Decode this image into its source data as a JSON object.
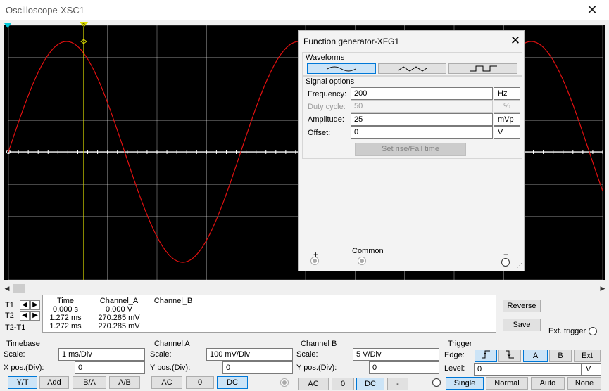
{
  "window": {
    "title": "Oscilloscope-XSC1",
    "close": "✕"
  },
  "cursors": {
    "t1": "1",
    "t2": "2"
  },
  "readout": {
    "headers": {
      "time": "Time",
      "channel_a": "Channel_A",
      "channel_b": "Channel_B"
    },
    "rows": [
      {
        "label": "T1",
        "time": "0.000 s",
        "channel_a": "0.000 V",
        "channel_b": ""
      },
      {
        "label": "T2",
        "time": "1.272 ms",
        "channel_a": "270.285 mV",
        "channel_b": ""
      },
      {
        "label": "T2-T1",
        "time": "1.272 ms",
        "channel_a": "270.285 mV",
        "channel_b": ""
      }
    ],
    "nav_left": "🡸",
    "nav_right": "🡺"
  },
  "buttons": {
    "reverse": "Reverse",
    "save": "Save",
    "ext_trigger": "Ext. trigger"
  },
  "timebase": {
    "title": "Timebase",
    "scale_label": "Scale:",
    "scale": "1 ms/Div",
    "xpos_label": "X pos.(Div):",
    "xpos": "0",
    "modes": [
      "Y/T",
      "Add",
      "B/A",
      "A/B"
    ],
    "selected_mode": "Y/T"
  },
  "channel_a": {
    "title": "Channel A",
    "scale_label": "Scale:",
    "scale": "100 mV/Div",
    "ypos_label": "Y pos.(Div):",
    "ypos": "0",
    "coupling": [
      "AC",
      "0",
      "DC"
    ],
    "selected": "DC"
  },
  "channel_b": {
    "title": "Channel B",
    "scale_label": "Scale:",
    "scale": "5  V/Div",
    "ypos_label": "Y pos.(Div):",
    "ypos": "0",
    "coupling": [
      "AC",
      "0",
      "DC",
      "-"
    ],
    "selected": "DC"
  },
  "trigger": {
    "title": "Trigger",
    "edge_label": "Edge:",
    "edges": [
      "⨍",
      "⨍̵"
    ],
    "sources": [
      "A",
      "B",
      "Ext"
    ],
    "selected_source": "A",
    "level_label": "Level:",
    "level": "0",
    "level_unit": "V",
    "modes": [
      "Single",
      "Normal",
      "Auto",
      "None"
    ],
    "selected_mode": "Single"
  },
  "function_generator": {
    "title": "Function generator-XFG1",
    "close": "✕",
    "waveforms_label": "Waveforms",
    "waveforms": [
      "sine",
      "triangle",
      "square"
    ],
    "selected_waveform": "sine",
    "signal_options_label": "Signal options",
    "frequency_label": "Frequency:",
    "frequency": "200",
    "frequency_unit": "Hz",
    "duty_label": "Duty cycle:",
    "duty": "50",
    "duty_unit": "%",
    "amplitude_label": "Amplitude:",
    "amplitude": "25",
    "amplitude_unit": "mVp",
    "offset_label": "Offset:",
    "offset": "0",
    "offset_unit": "V",
    "rise_fall_button": "Set rise/Fall time",
    "plus": "+",
    "common": "Common",
    "minus": "−"
  },
  "trace": {
    "color": "#e01010",
    "grid_color": "#ffffff",
    "background": "#000000",
    "cursor_color": "#e0e000"
  }
}
